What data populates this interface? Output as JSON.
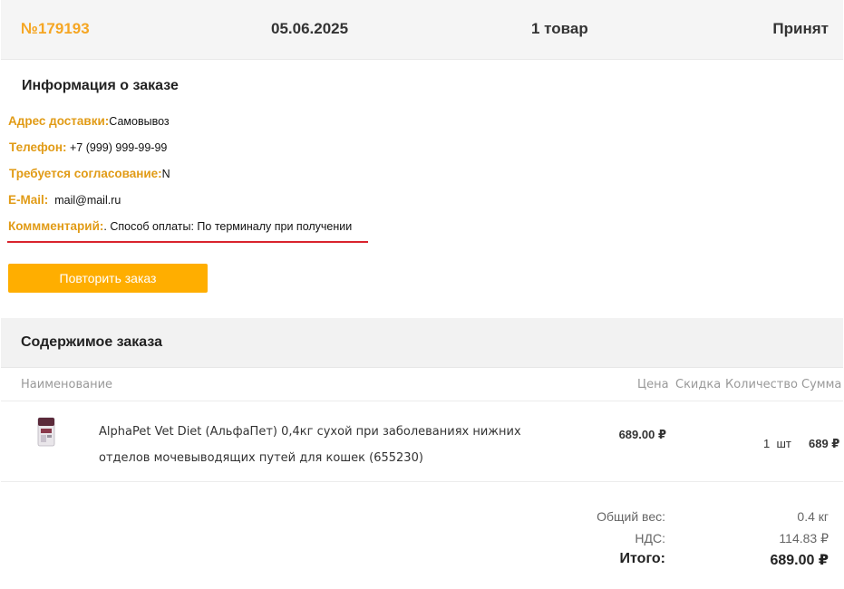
{
  "header": {
    "order_number": "№179193",
    "date": "05.06.2025",
    "items_count": "1 товар",
    "status": "Принят"
  },
  "info": {
    "title": "Информация о заказе",
    "rows": [
      {
        "label": "Адрес доставки:",
        "value": "Самовывоз"
      },
      {
        "label": "Телефон:",
        "value": " +7 (999) 999-99-99"
      },
      {
        "label": "Требуется согласование:",
        "value": "N"
      },
      {
        "label": "E-Mail:",
        "value": "  mail@mail.ru"
      },
      {
        "label": "Коммментарий:",
        "value": ". Способ оплаты: По терминалу при получении"
      }
    ],
    "repeat_button": "Повторить заказ"
  },
  "contents": {
    "title": "Содержимое заказа",
    "columns": {
      "name": "Наименование",
      "price": "Цена",
      "discount": "Скидка",
      "quantity": "Количество",
      "sum": "Сумма"
    },
    "items": [
      {
        "name": "AlphaPet Vet Diet (АльфаПет) 0,4кг сухой при заболеваниях нижних отделов мочевыводящих путей для кошек (655230)",
        "price": "689.00 ₽",
        "discount": "",
        "quantity": "1  шт",
        "sum": "689 ₽",
        "thumbnail_icon": "product-package-icon"
      }
    ]
  },
  "totals": {
    "weight_label": "Общий вес:",
    "weight_value": "0.4 кг",
    "vat_label": "НДС:",
    "vat_value": "114.83 ₽",
    "total_label": "Итого:",
    "total_value": "689.00 ₽"
  },
  "colors": {
    "accent": "#f5a623",
    "button": "#ffae00",
    "label": "#e19b16",
    "underline": "#d9232d"
  }
}
